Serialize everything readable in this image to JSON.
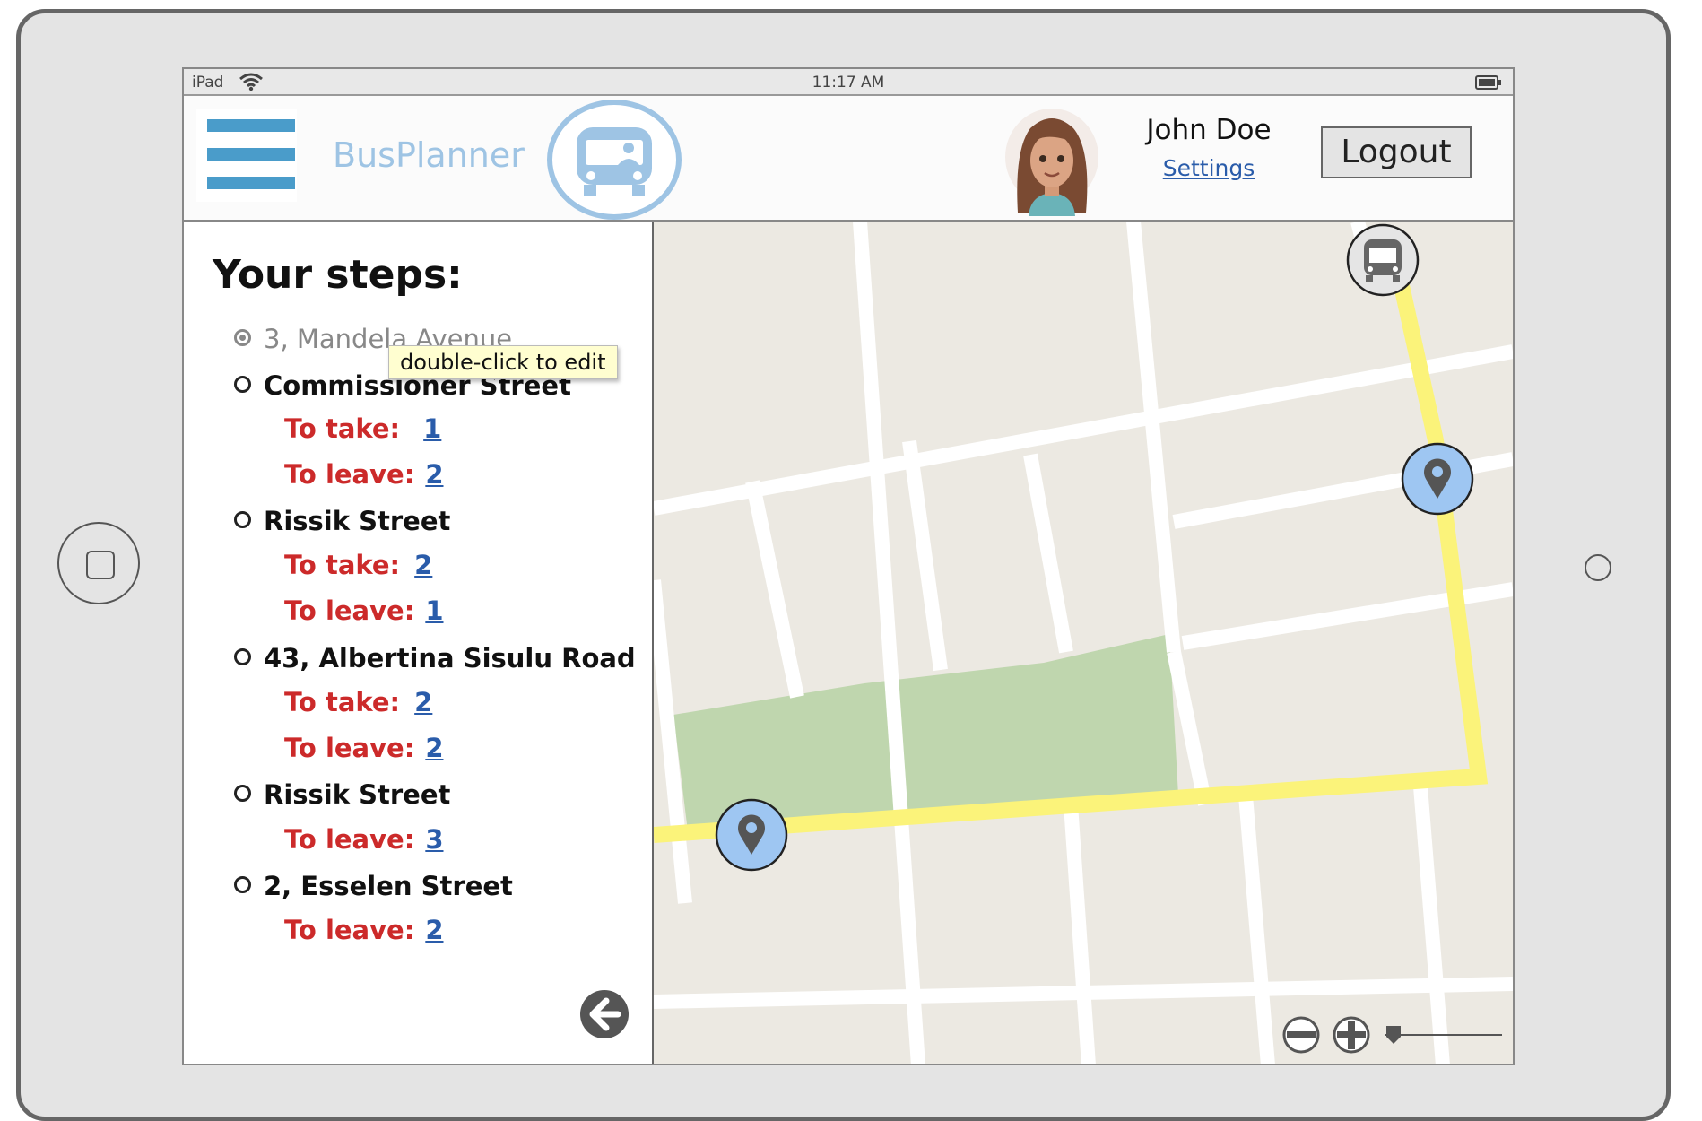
{
  "device": {
    "label": "iPad",
    "time": "11:17 AM"
  },
  "header": {
    "app_title": "BusPlanner",
    "user_name": "John Doe",
    "settings_label": "Settings",
    "logout_label": "Logout"
  },
  "steps": {
    "title": "Your steps:",
    "tooltip": "double-click to edit",
    "items": [
      {
        "name": "3, Mandela Avenue",
        "checked": true
      },
      {
        "name": "Commissioner Street",
        "take": "1",
        "leave": "2"
      },
      {
        "name": "Rissik Street",
        "take": "2",
        "leave": "1"
      },
      {
        "name": "43, Albertina Sisulu Road",
        "take": "2",
        "leave": "2"
      },
      {
        "name": "Rissik Street",
        "leave": "3"
      },
      {
        "name": "2, Esselen Street",
        "leave": "2"
      }
    ],
    "take_label": "To take:",
    "leave_label": "To leave:"
  },
  "colors": {
    "accent": "#4a9cca",
    "route": "#fbf37a",
    "park": "#bfd6ae",
    "map_bg": "#ece9e2",
    "pin_fill": "#9ec6f2",
    "line_label": "#cc2a2a",
    "link": "#2a5caa"
  },
  "icons": {
    "menu": "hamburger-menu-icon",
    "logo": "bus-icon",
    "bus_marker": "bus-icon",
    "pins": "map-pin-icon",
    "back": "arrow-left-circle-icon",
    "zoom_out": "minus-circle-icon",
    "zoom_in": "plus-circle-icon"
  }
}
